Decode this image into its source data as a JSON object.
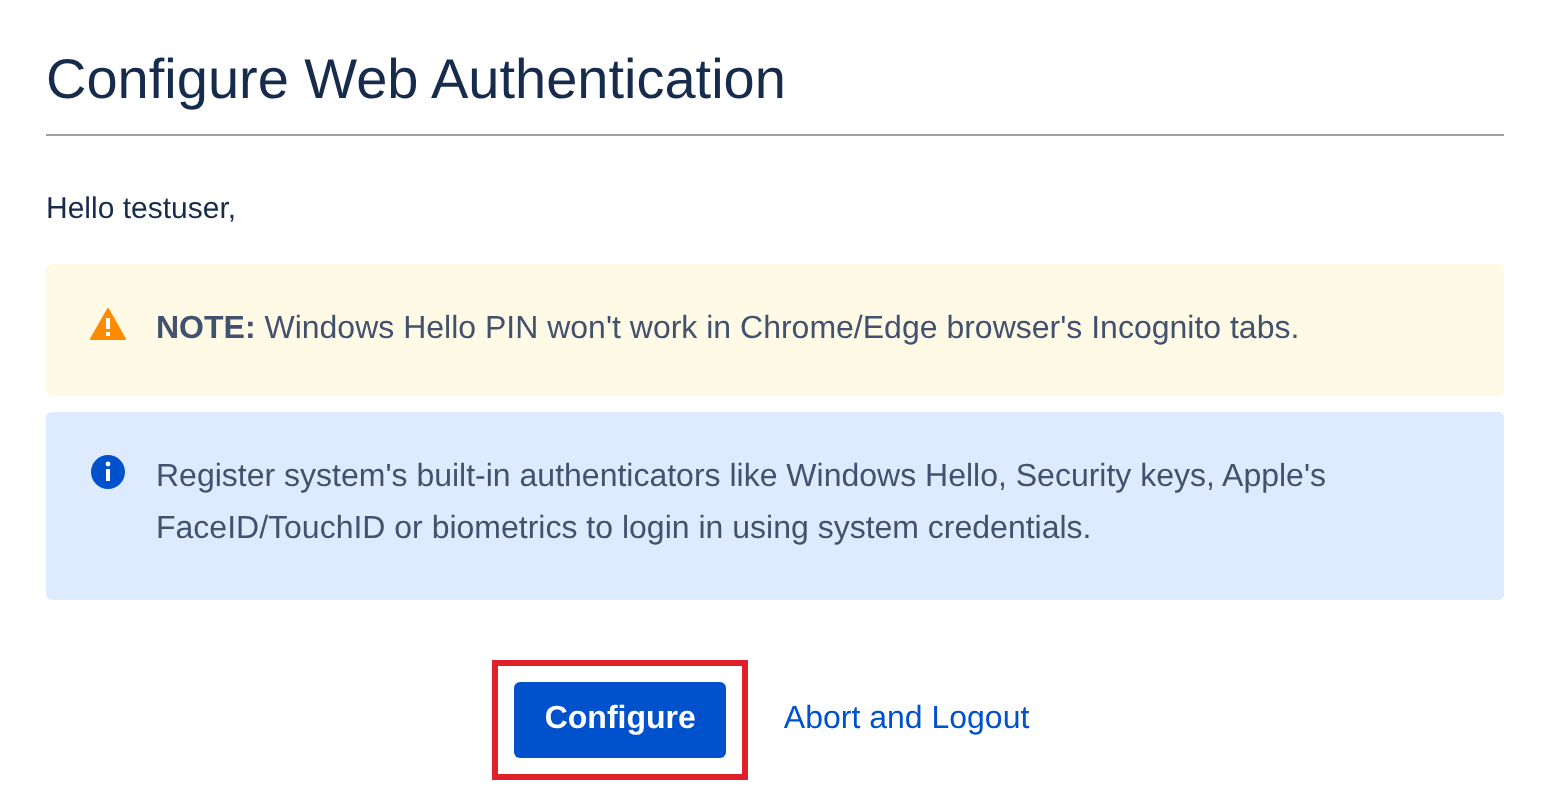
{
  "title": "Configure Web Authentication",
  "greeting": "Hello testuser,",
  "messages": [
    {
      "kind": "warning",
      "text": "**NOTE:** Windows Hello PIN won't work in Chrome/Edge browser's Incognito tabs."
    },
    {
      "kind": "info",
      "text": "Register system's built-in authenticators like Windows Hello, Security keys, Apple's FaceID/TouchID or biometrics to login in using system credentials."
    }
  ],
  "primary_button": {
    "label": "Configure",
    "highlighted": true
  },
  "link": {
    "label": "Abort and Logout"
  }
}
